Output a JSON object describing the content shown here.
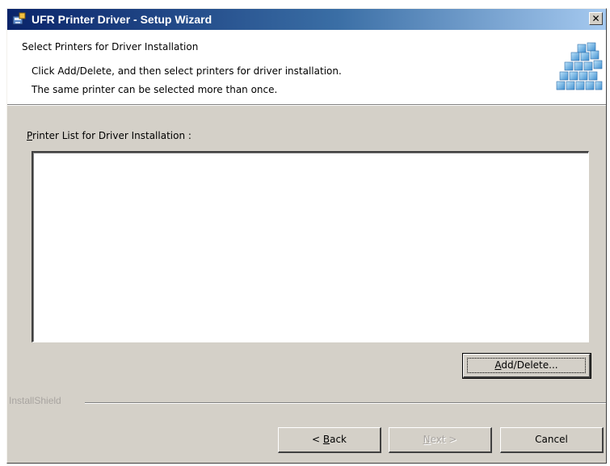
{
  "window": {
    "title": "UFR Printer Driver - Setup Wizard",
    "close_glyph": "✕"
  },
  "header": {
    "title": "Select Printers for Driver Installation",
    "line1": "Click Add/Delete, and then select printers for driver installation.",
    "line2": "The same printer can be selected more than once.",
    "graphic_icon": "printer-stack-icon"
  },
  "printer_list": {
    "label_mnemonic": "P",
    "label_rest": "rinter List for Driver Installation :",
    "items": []
  },
  "buttons": {
    "add_delete_mnemonic": "A",
    "add_delete_rest": "dd/Delete...",
    "back_prefix": "< ",
    "back_mnemonic": "B",
    "back_rest": "ack",
    "next_mnemonic": "N",
    "next_rest": "ext >",
    "cancel": "Cancel"
  },
  "footer": {
    "brand": "InstallShield"
  },
  "colors": {
    "titlebar_start": "#0a246a",
    "titlebar_end": "#a6caf0",
    "dialog_face": "#d4d0c8"
  }
}
